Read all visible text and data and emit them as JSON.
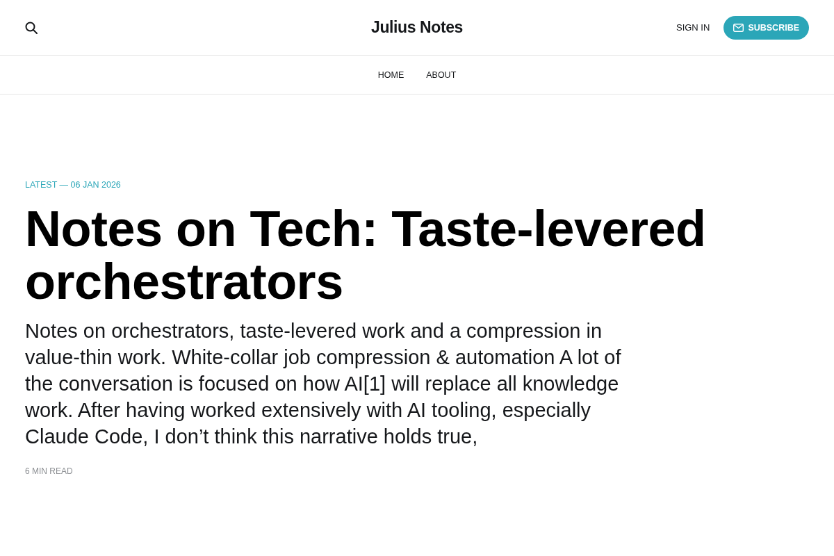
{
  "header": {
    "site_title": "Julius Notes",
    "sign_in": "SIGN IN",
    "subscribe": "SUBSCRIBE"
  },
  "nav": {
    "items": [
      {
        "label": "HOME"
      },
      {
        "label": "ABOUT"
      }
    ]
  },
  "post": {
    "kicker": "LATEST — 06 JAN 2026",
    "title": "Notes on Tech: Taste-levered orchestrators",
    "excerpt": "Notes on orchestrators, taste-levered work and a compression in value-thin work. White-collar job compression & automation A lot of the conversation is focused on how AI[1] will replace all knowledge work. After having worked extensively with AI tooling, especially Claude Code, I don’t think this narrative holds true,",
    "reading_time": "6 MIN READ"
  }
}
